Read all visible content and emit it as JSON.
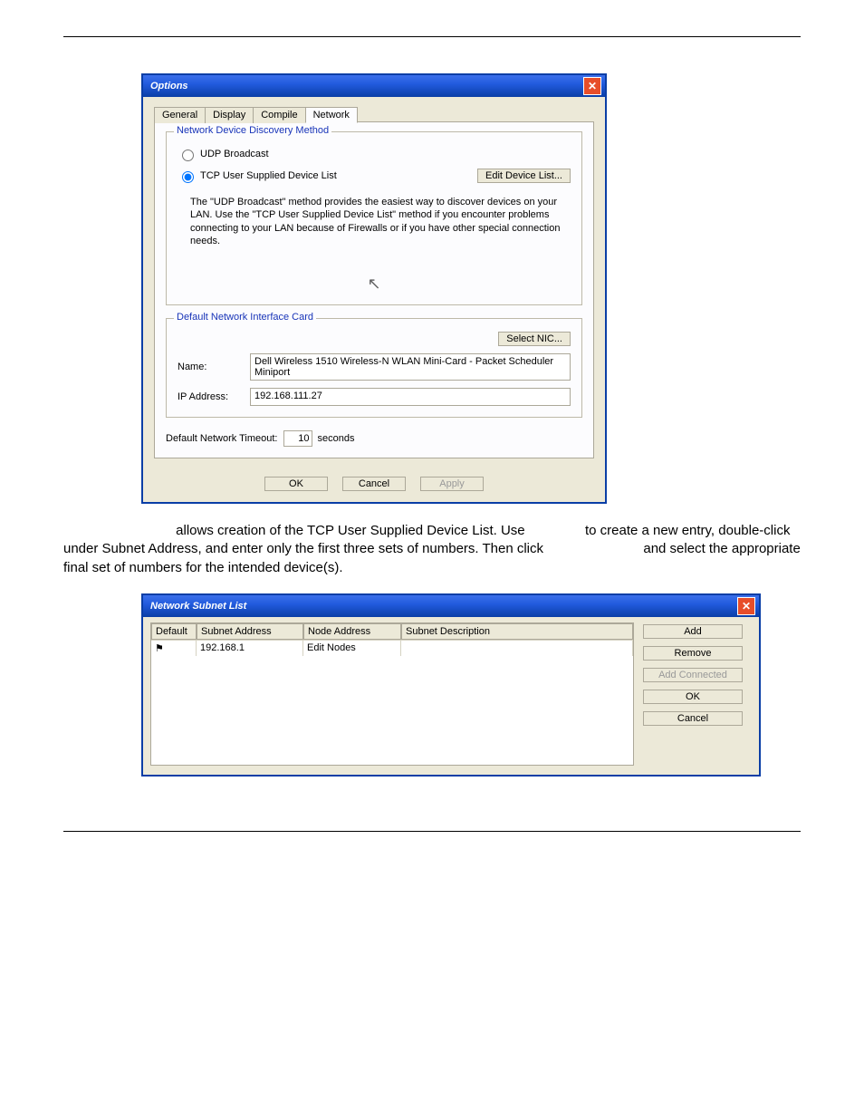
{
  "options_dialog": {
    "title": "Options",
    "tabs": {
      "general": "General",
      "display": "Display",
      "compile": "Compile",
      "network": "Network"
    },
    "group_discovery": {
      "title": "Network Device Discovery Method",
      "radio_udp": "UDP Broadcast",
      "radio_tcp": "TCP User Supplied Device List",
      "edit_btn": "Edit Device List...",
      "desc": "The \"UDP Broadcast\" method provides the easiest way to discover devices on your LAN.  Use the \"TCP User Supplied Device List\" method if you encounter problems connecting to your LAN because of Firewalls or if you have other special connection needs."
    },
    "group_nic": {
      "title": "Default Network Interface Card",
      "select_btn": "Select NIC...",
      "name_label": "Name:",
      "name_value": "Dell Wireless 1510 Wireless-N WLAN Mini-Card - Packet Scheduler Miniport",
      "ip_label": "IP Address:",
      "ip_value": "192.168.111.27"
    },
    "timeout": {
      "label": "Default Network Timeout:",
      "value": "10",
      "unit": "seconds"
    },
    "buttons": {
      "ok": "OK",
      "cancel": "Cancel",
      "apply": "Apply"
    }
  },
  "paragraph": {
    "l1a": " allows creation of the TCP User Supplied Device List. Use ",
    "l1b": " to create a new entry, double-click under Subnet Address, and enter only the first three sets of numbers. Then click ",
    "l1c": " and select the appropriate final set of numbers for the intended device(s)."
  },
  "subnet_dialog": {
    "title": "Network Subnet List",
    "headers": {
      "default": "Default",
      "subnet": "Subnet Address",
      "node": "Node Address",
      "desc": "Subnet Description"
    },
    "row": {
      "subnet": "192.168.1",
      "node": "Edit Nodes"
    },
    "buttons": {
      "add": "Add",
      "remove": "Remove",
      "add_connected": "Add Connected",
      "ok": "OK",
      "cancel": "Cancel"
    }
  }
}
